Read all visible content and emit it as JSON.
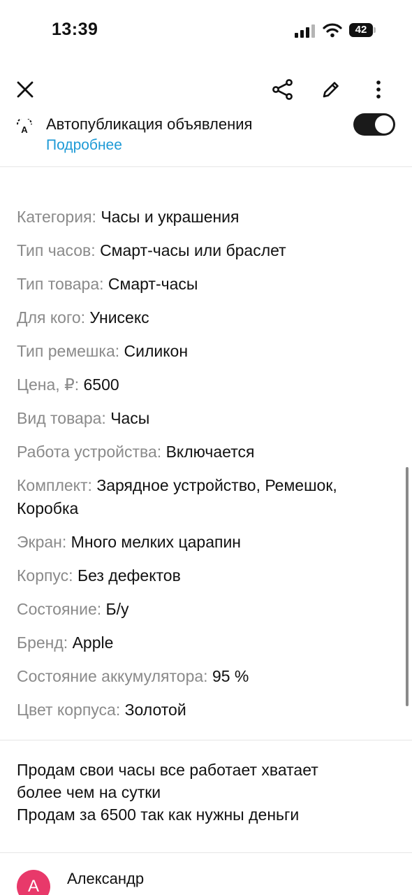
{
  "status_bar": {
    "time": "13:39",
    "battery": "42"
  },
  "toolbar": {
    "icons": [
      "close-icon",
      "share-icon",
      "edit-icon",
      "more-vertical-icon"
    ]
  },
  "autopublish": {
    "title": "Автопубликация объявления",
    "link": "Подробнее",
    "enabled": true
  },
  "params": [
    {
      "key": "Категория:",
      "value": "Часы и украшения"
    },
    {
      "key": "Тип часов:",
      "value": "Смарт-часы или браслет"
    },
    {
      "key": "Тип товара:",
      "value": "Смарт-часы"
    },
    {
      "key": "Для кого:",
      "value": "Унисекс"
    },
    {
      "key": "Тип ремешка:",
      "value": "Силикон"
    },
    {
      "key": "Цена, ₽:",
      "value": "6500"
    },
    {
      "key": "Вид товара:",
      "value": "Часы"
    },
    {
      "key": "Работа устройства:",
      "value": "Включается"
    },
    {
      "key": "Комплект:",
      "value": "Зарядное устройство, Ремешок, Коробка"
    },
    {
      "key": "Экран:",
      "value": "Много мелких царапин"
    },
    {
      "key": "Корпус:",
      "value": "Без дефектов"
    },
    {
      "key": "Состояние:",
      "value": "Б/у"
    },
    {
      "key": "Бренд:",
      "value": "Apple"
    },
    {
      "key": "Состояние аккумулятора:",
      "value": "95 %"
    },
    {
      "key": "Цвет корпуса:",
      "value": "Золотой"
    }
  ],
  "description": {
    "lines": [
      "Продам свои часы все работает хватает",
      "более чем на сутки",
      "Продам за 6500 так как нужны деньги"
    ]
  },
  "seller": {
    "avatar_letter": "А",
    "name": "Александр",
    "avatar_color": "#e8396a"
  },
  "colors": {
    "link": "#1e9ad6",
    "label": "#8a8a8a",
    "toggle": "#1a1a1a"
  }
}
